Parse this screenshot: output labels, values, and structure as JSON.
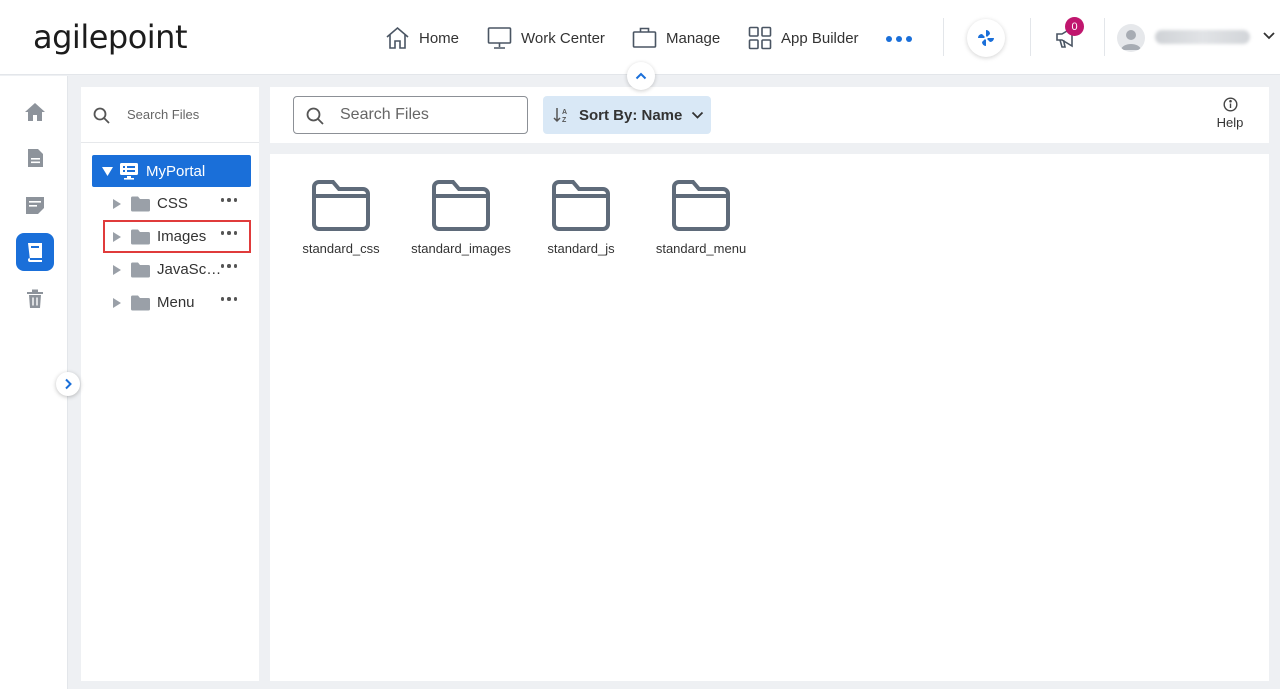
{
  "header": {
    "logo_text": "agilepoint",
    "nav": [
      {
        "label": "Home",
        "icon": "home-icon"
      },
      {
        "label": "Work Center",
        "icon": "monitor-icon"
      },
      {
        "label": "Manage",
        "icon": "briefcase-icon"
      },
      {
        "label": "App Builder",
        "icon": "grid-icon"
      }
    ],
    "more_icon": "more-horizontal-icon",
    "notification_count": "0",
    "user_name_redacted": true
  },
  "rail": {
    "items": [
      {
        "name": "home",
        "icon": "home-icon",
        "active": false
      },
      {
        "name": "documents",
        "icon": "document-icon",
        "active": false
      },
      {
        "name": "forms",
        "icon": "form-icon",
        "active": false
      },
      {
        "name": "portal-files",
        "icon": "book-icon",
        "active": true
      },
      {
        "name": "recycle-bin",
        "icon": "trash-icon",
        "active": false
      }
    ]
  },
  "tree": {
    "search_placeholder": "Search Files",
    "root": "MyPortal",
    "folders": [
      {
        "label": "CSS",
        "highlighted": false
      },
      {
        "label": "Images",
        "highlighted": true
      },
      {
        "label": "JavaScript",
        "highlighted": false
      },
      {
        "label": "Menu",
        "highlighted": false
      }
    ]
  },
  "toolbar": {
    "search_placeholder": "Search Files",
    "sort_label": "Sort By: Name",
    "help_label": "Help"
  },
  "content": {
    "files": [
      {
        "name": "standard_css"
      },
      {
        "name": "standard_images"
      },
      {
        "name": "standard_js"
      },
      {
        "name": "standard_menu"
      }
    ]
  },
  "colors": {
    "accent": "#1a6fd9",
    "sort_bg": "#d9e8f6",
    "badge": "#c0166e",
    "highlight_border": "#e03b3b",
    "folder_stroke": "#5f6b7a"
  }
}
